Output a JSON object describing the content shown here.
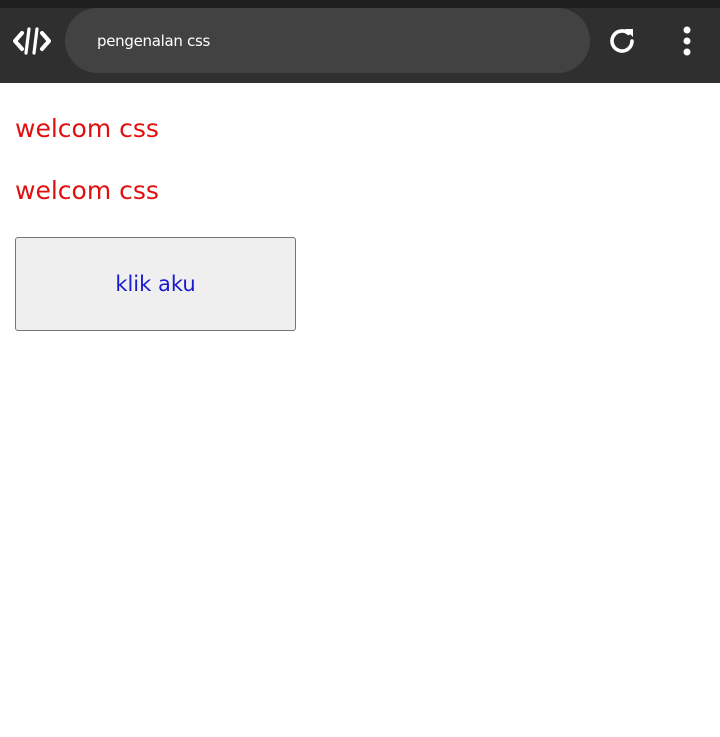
{
  "browser": {
    "title": "pengenalan css",
    "logo_icon": "code-logo-icon",
    "reload_icon": "reload-icon",
    "menu_icon": "more-vertical-icon",
    "bar_color": "#2f2f2f"
  },
  "page": {
    "headings": [
      "welcom css",
      "welcom css"
    ],
    "button_label": "klik aku",
    "heading_color": "#e01010",
    "button_text_color": "#1a1ad0"
  }
}
